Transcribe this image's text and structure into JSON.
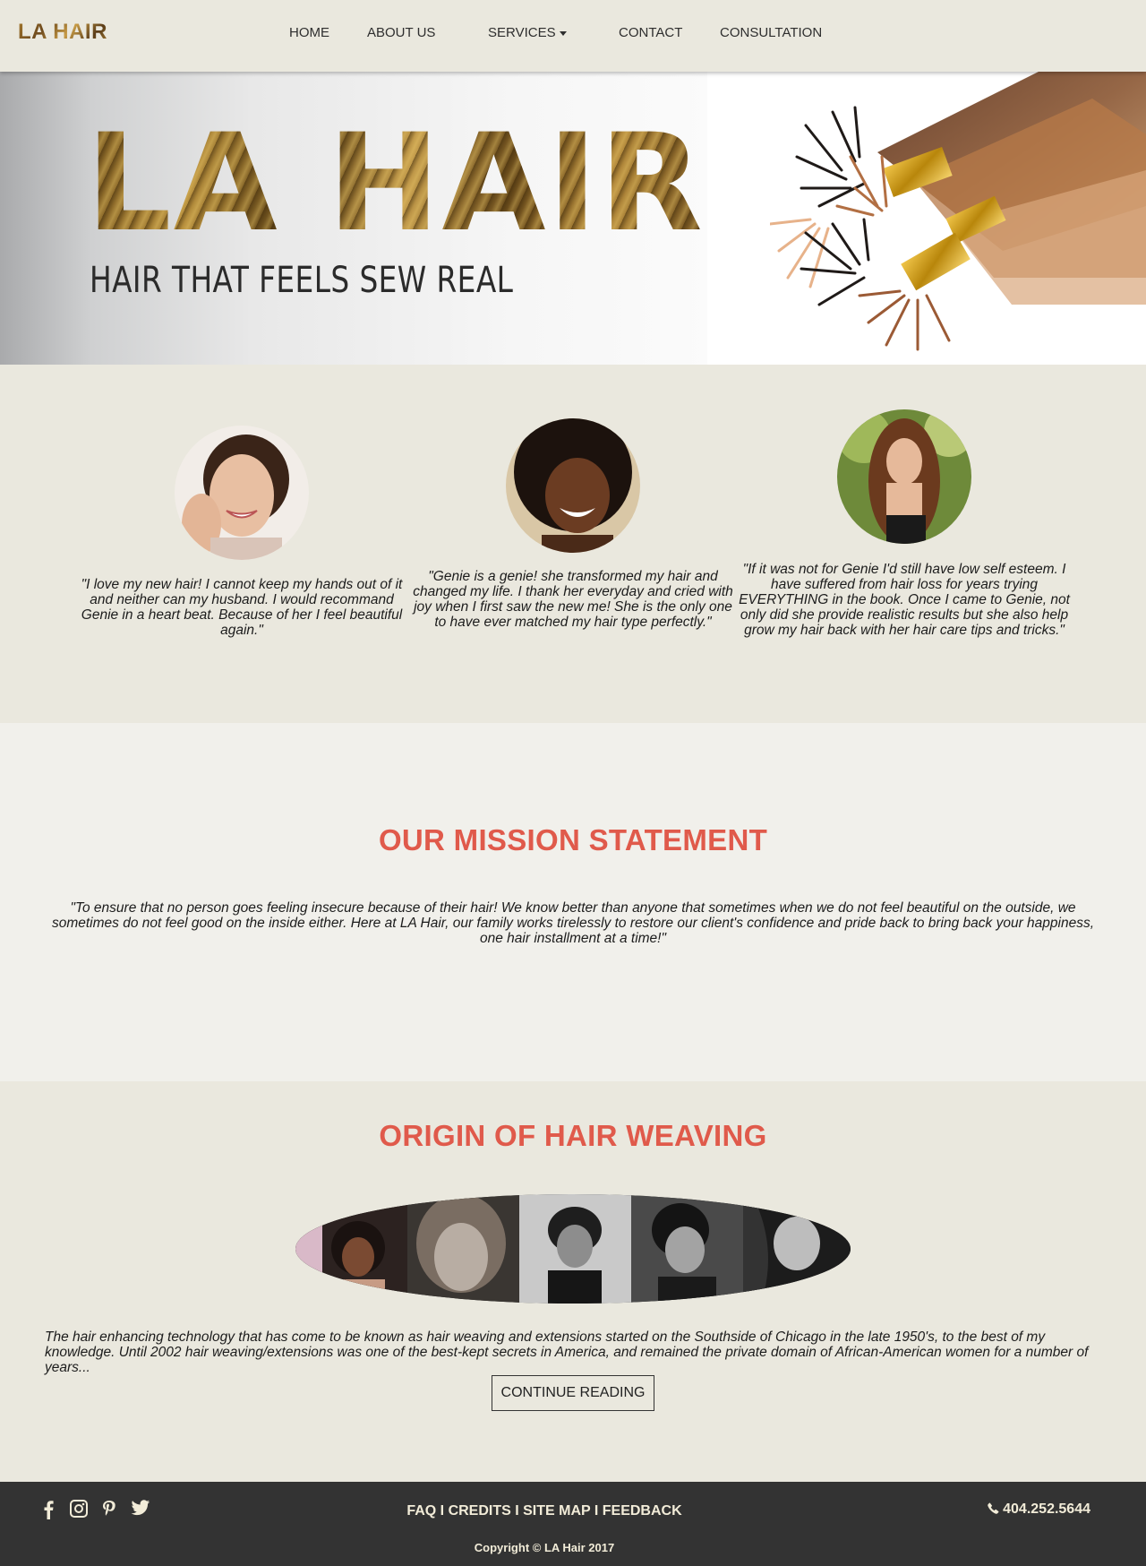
{
  "brand": {
    "logo": "LA HAIR"
  },
  "nav": {
    "home": "HOME",
    "about": "ABOUT US",
    "services": "SERVICES",
    "contact": "CONTACT",
    "consultation": "CONSULTATION"
  },
  "hero": {
    "title": "LA HAIR",
    "subtitle": "HAIR THAT FEELS SEW REAL"
  },
  "testimonials": [
    {
      "quote": "\"I love my new hair! I cannot keep my hands out of it and neither can my husband. I would recommand Genie in a heart beat. Because of her I feel beautiful again.\""
    },
    {
      "quote": "\"Genie is a genie! she transformed my hair and changed my life. I thank her everyday and cried with joy when I first saw the new me! She is the only one to have ever matched my hair type perfectly.\""
    },
    {
      "quote": "\"If it was not for Genie I'd still have low self esteem. I have suffered from hair loss for years trying EVERYTHING in the book. Once I came to Genie, not only did she provide realistic results but she also help grow my hair back with her hair care tips and tricks.\""
    }
  ],
  "mission": {
    "title": "OUR MISSION STATEMENT",
    "text": "\"To ensure that no person goes feeling insecure because of their hair! We know better than anyone that sometimes when we do not feel beautiful on the outside, we sometimes do not feel good on the inside either. Here at LA Hair, our family works tirelessly to restore our client's confidence and pride back to bring back your happiness, one hair installment at a time!\""
  },
  "origin": {
    "title": "ORIGIN OF HAIR WEAVING",
    "text": "The hair enhancing technology that has come to be known as hair weaving and extensions started on the Southside of Chicago in the late 1950's, to the best of my knowledge. Until 2002 hair weaving/extensions was one of the best-kept secrets in America, and remained the private domain of African-American women for a number of years...",
    "button": "CONTINUE READING"
  },
  "footer": {
    "social": [
      "facebook-icon",
      "instagram-icon",
      "pinterest-icon",
      "twitter-icon"
    ],
    "links": "FAQ I CREDITS I SITE MAP I FEEDBACK",
    "phone": "404.252.5644",
    "copyright": "Copyright © LA Hair 2017"
  },
  "colors": {
    "accent": "#e05a4b",
    "background": "#eae8de",
    "mission_background": "#f1f0eb",
    "footer": "#333333"
  }
}
